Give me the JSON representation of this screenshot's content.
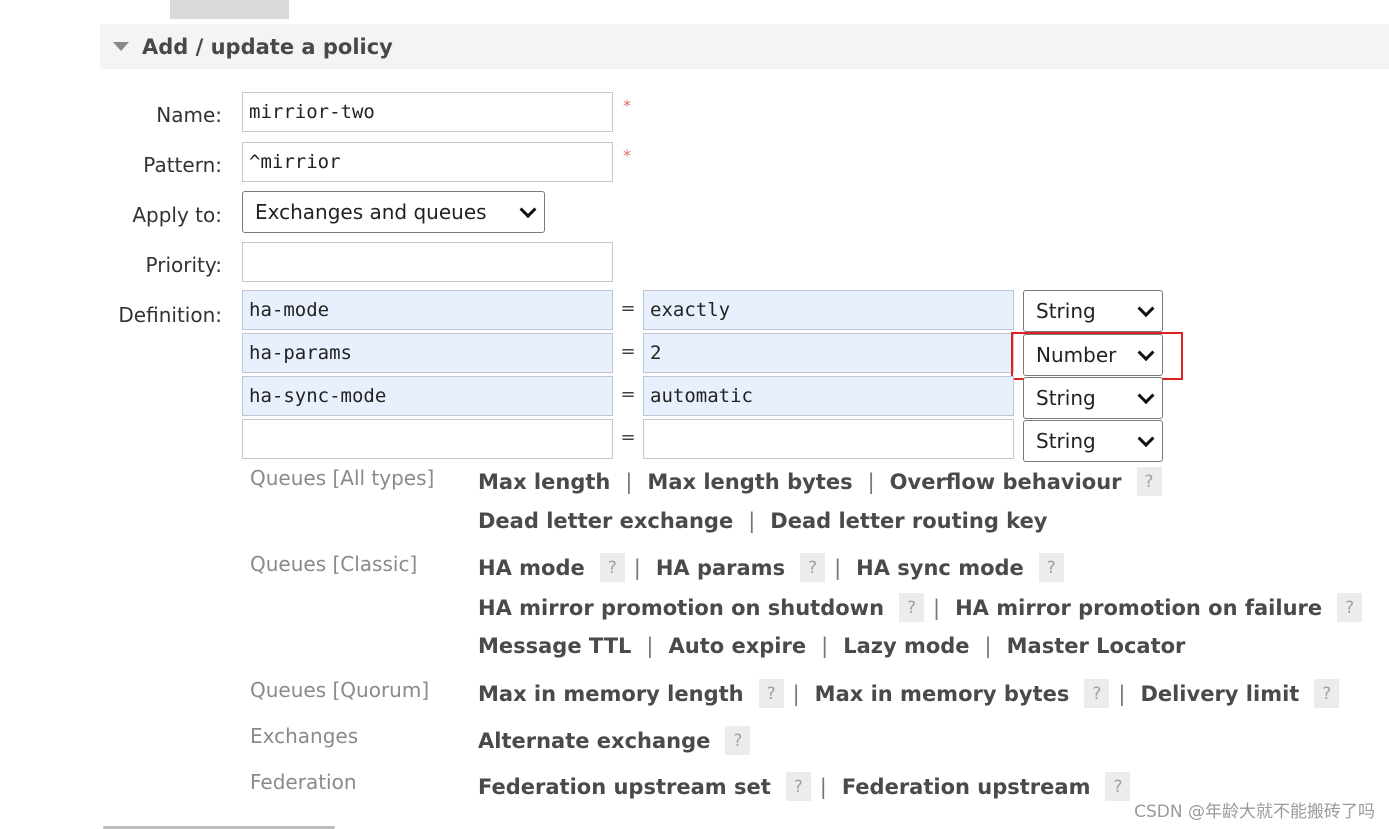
{
  "section": {
    "title": "Add / update a policy"
  },
  "form": {
    "name_label": "Name:",
    "name_value": "mirrior-two",
    "pattern_label": "Pattern:",
    "pattern_value": "^mirrior",
    "required_mark": "*",
    "apply_label": "Apply to:",
    "apply_value": "Exchanges and queues",
    "priority_label": "Priority:",
    "priority_value": "",
    "definition_label": "Definition:",
    "definitions": [
      {
        "key": "ha-mode",
        "eq": "=",
        "value": "exactly",
        "type": "String"
      },
      {
        "key": "ha-params",
        "eq": "=",
        "value": "2",
        "type": "Number"
      },
      {
        "key": "ha-sync-mode",
        "eq": "=",
        "value": "automatic",
        "type": "String"
      },
      {
        "key": "",
        "eq": "=",
        "value": "",
        "type": "String"
      }
    ]
  },
  "help": {
    "help_mark": "?",
    "separator": "|",
    "queues_all": {
      "label": "Queues [All types]",
      "line1": [
        "Max length",
        "Max length bytes",
        "Overflow behaviour"
      ],
      "line2": [
        "Dead letter exchange",
        "Dead letter routing key"
      ]
    },
    "queues_classic": {
      "label": "Queues [Classic]",
      "line1": [
        "HA mode",
        "HA params",
        "HA sync mode"
      ],
      "line2": [
        "HA mirror promotion on shutdown",
        "HA mirror promotion on failure"
      ],
      "line3": [
        "Message TTL",
        "Auto expire",
        "Lazy mode",
        "Master Locator"
      ]
    },
    "queues_quorum": {
      "label": "Queues [Quorum]",
      "line1": [
        "Max in memory length",
        "Max in memory bytes",
        "Delivery limit"
      ]
    },
    "exchanges": {
      "label": "Exchanges",
      "line1": [
        "Alternate exchange"
      ]
    },
    "federation": {
      "label": "Federation",
      "line1": [
        "Federation upstream set",
        "Federation upstream"
      ]
    }
  },
  "watermark": "CSDN @年龄大就不能搬砖了吗"
}
